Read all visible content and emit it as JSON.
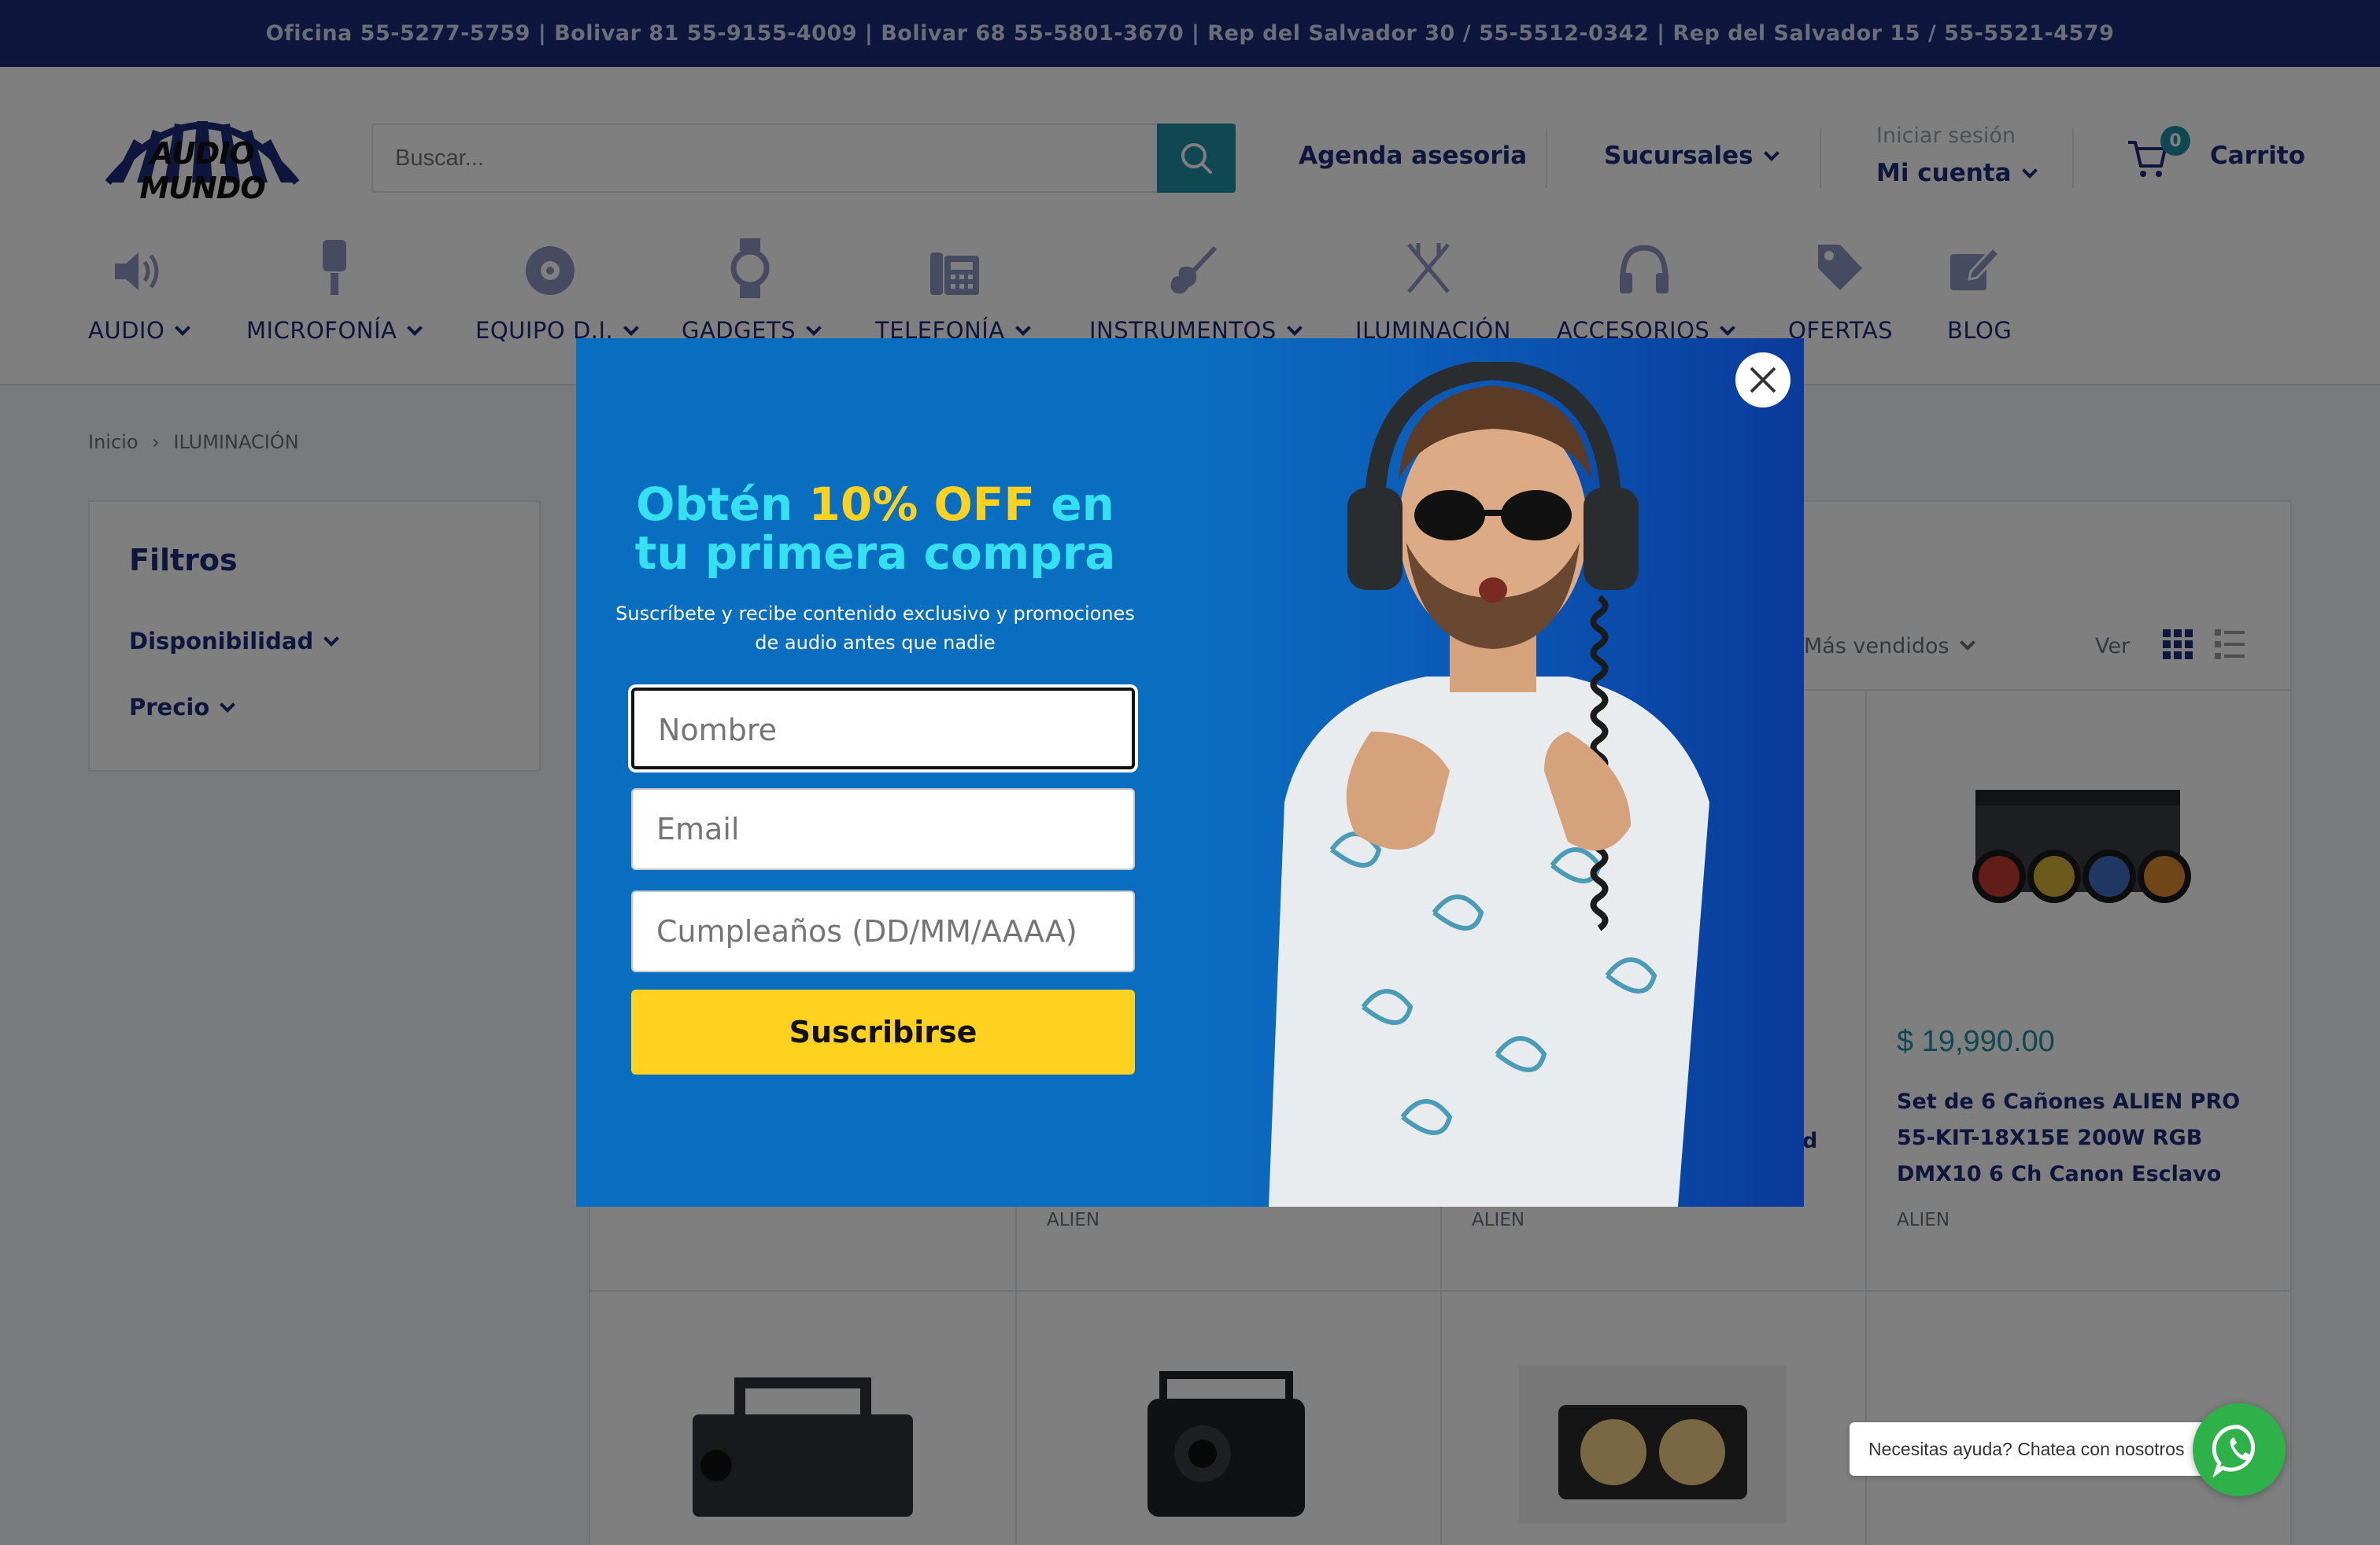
{
  "topbar": {
    "text": "Oficina 55-5277-5759 | Bolivar 81 55-9155-4009 | Bolivar 68 55-5801-3670 | Rep del Salvador 30 / 55-5512-0342 | Rep del Salvador 15 / 55-5521-4579"
  },
  "header": {
    "logo_text": "AUDIO MUNDO",
    "search_placeholder": "Buscar...",
    "agenda": "Agenda asesoria",
    "sucursales": "Sucursales",
    "login_small": "Iniciar sesión",
    "account": "Mi cuenta",
    "cart_count": "0",
    "cart": "Carrito"
  },
  "nav": [
    {
      "label": "AUDIO",
      "icon": "speaker-icon"
    },
    {
      "label": "MICROFONÍA",
      "icon": "microphone-icon"
    },
    {
      "label": "EQUIPO D.J.",
      "icon": "vinyl-icon"
    },
    {
      "label": "GADGETS",
      "icon": "watch-icon"
    },
    {
      "label": "TELEFONÍA",
      "icon": "phone-icon"
    },
    {
      "label": "INSTRUMENTOS",
      "icon": "guitar-icon"
    },
    {
      "label": "ILUMINACIÓN",
      "icon": "light-icon"
    },
    {
      "label": "ACCESORIOS",
      "icon": "headphones-icon"
    },
    {
      "label": "OFERTAS",
      "icon": "tag-icon"
    },
    {
      "label": "BLOG",
      "icon": "pen-icon"
    }
  ],
  "breadcrumb": {
    "home": "Inicio",
    "current": "ILUMINACIÓN"
  },
  "filters": {
    "title": "Filtros",
    "availability": "Disponibilidad",
    "price": "Precio"
  },
  "toolbar": {
    "sort": "Más vendidos",
    "view": "Ver"
  },
  "products": {
    "featured": {
      "price": "$ 19,990.00",
      "title": "Set de 6 Cañones ALIEN PRO 55-KIT-18X15E 200W RGB DMX10 6 Ch Canon Esclavo",
      "brand": "ALIEN"
    },
    "brand_2": "ALIEN",
    "brand_3": "ALIEN",
    "partial_3": "d"
  },
  "popup": {
    "title_a": "Obtén ",
    "title_hl": "10% OFF",
    "title_b": " en tu primera compra",
    "subtitle": "Suscríbete y recibe contenido exclusivo y promociones de audio antes que nadie",
    "name_placeholder": "Nombre",
    "email_placeholder": "Email",
    "birthday_placeholder": "Cumpleaños (DD/MM/AAAA)",
    "submit": "Suscribirse"
  },
  "whatsapp": {
    "text": "Necesitas ayuda? Chatea con nosotros"
  },
  "colors": {
    "brand_navy": "#1e2d7d",
    "accent_teal": "#1e8ea5",
    "popup_blue": "#0a6ec0",
    "cta_yellow": "#ffd21f",
    "whatsapp_green": "#2fb14a"
  }
}
